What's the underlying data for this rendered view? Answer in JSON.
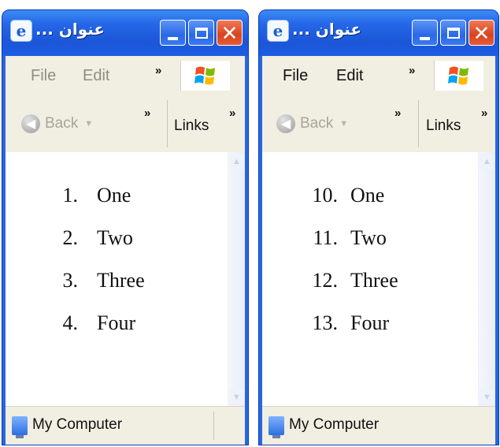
{
  "windows": [
    {
      "title": "... عنوان",
      "menu": {
        "file": "File",
        "edit": "Edit",
        "chevron": "»"
      },
      "toolbar": {
        "back": "Back",
        "chevron": "»",
        "links": "Links",
        "links_chevron": "»"
      },
      "list": [
        {
          "num": "1.",
          "text": "One"
        },
        {
          "num": "2.",
          "text": "Two"
        },
        {
          "num": "3.",
          "text": "Three"
        },
        {
          "num": "4.",
          "text": "Four"
        }
      ],
      "status": "My Computer"
    },
    {
      "title": "... عنوان",
      "menu": {
        "file": "File",
        "edit": "Edit",
        "chevron": "»"
      },
      "toolbar": {
        "back": "Back",
        "chevron": "»",
        "links": "Links",
        "links_chevron": "»"
      },
      "list": [
        {
          "num": "10.",
          "text": "One"
        },
        {
          "num": "11.",
          "text": "Two"
        },
        {
          "num": "12.",
          "text": "Three"
        },
        {
          "num": "13.",
          "text": "Four"
        }
      ],
      "status": "My Computer"
    }
  ],
  "icons": {
    "app": "ie-icon",
    "minimize": "minimize-icon",
    "maximize": "maximize-icon",
    "close": "close-icon",
    "logo": "windows-logo-icon",
    "back": "back-arrow-icon",
    "status": "my-computer-icon"
  },
  "colors": {
    "titlebar": "#2567e8",
    "close_button": "#d8431e",
    "chrome": "#f1efe2"
  }
}
